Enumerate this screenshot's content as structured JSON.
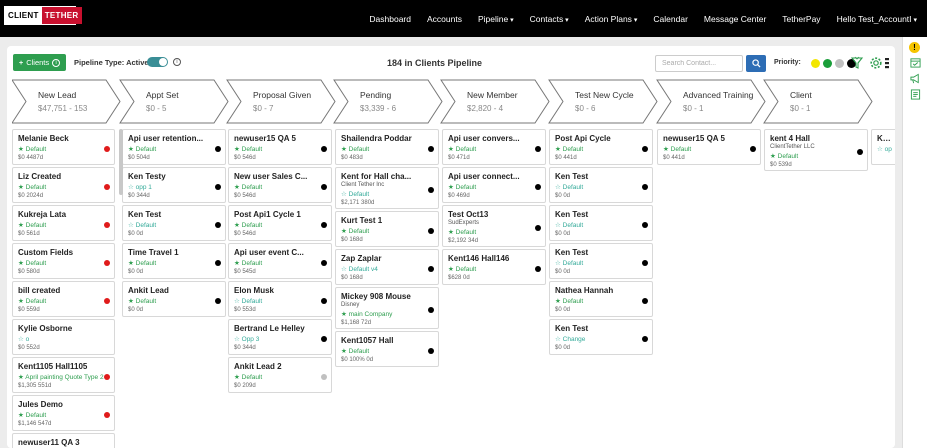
{
  "logo": {
    "part1": "CLIENT",
    "part2": "TETHER"
  },
  "nav": {
    "items": [
      {
        "label": "Dashboard",
        "dropdown": false
      },
      {
        "label": "Accounts",
        "dropdown": false
      },
      {
        "label": "Pipeline",
        "dropdown": true
      },
      {
        "label": "Contacts",
        "dropdown": true
      },
      {
        "label": "Action Plans",
        "dropdown": true
      },
      {
        "label": "Calendar",
        "dropdown": false
      },
      {
        "label": "Message Center",
        "dropdown": false
      },
      {
        "label": "TetherPay",
        "dropdown": false
      },
      {
        "label": "Hello Test_AccountI",
        "dropdown": true
      }
    ]
  },
  "toolbar": {
    "add_button_label": "Clients",
    "pipeline_type_label": "Pipeline Type: Active",
    "toggle_on": true,
    "title": "184 in Clients Pipeline",
    "search_placeholder": "Search Contact...",
    "priority_label": "Priority:",
    "priority_colors": [
      "#f2e600",
      "#1a9e3a",
      "#c0c0c0",
      "#000000"
    ]
  },
  "stages": [
    {
      "name": "New Lead",
      "summary": "$47,751 - 153"
    },
    {
      "name": "Appt Set",
      "summary": "$0 - 5"
    },
    {
      "name": "Proposal Given",
      "summary": "$0 - 7"
    },
    {
      "name": "Pending",
      "summary": "$3,339 - 6"
    },
    {
      "name": "New Member",
      "summary": "$2,820 - 4"
    },
    {
      "name": "Test New Cycle",
      "summary": "$0 - 6"
    },
    {
      "name": "Advanced Training",
      "summary": "$0 - 1"
    },
    {
      "name": "Client",
      "summary": "$0 - 1"
    }
  ],
  "columns": [
    {
      "cards": [
        {
          "name": "Melanie Beck",
          "tag": "Default",
          "meta": "$0  4487d",
          "dot": "#e01b1b"
        },
        {
          "name": "Liz Created",
          "tag": "Default",
          "meta": "$0  2024d",
          "dot": "#e01b1b"
        },
        {
          "name": "Kukreja Lata",
          "tag": "Default",
          "meta": "$0  561d",
          "dot": "#e01b1b"
        },
        {
          "name": "Custom Fields",
          "tag": "Default",
          "meta": "$0  580d",
          "dot": "#e01b1b"
        },
        {
          "name": "bill created",
          "tag": "Default",
          "meta": "$0  559d",
          "dot": "#e01b1b"
        },
        {
          "name": "Kylie Osborne",
          "tag": "o",
          "tag_outline": true,
          "meta": "$0  552d",
          "dot": ""
        },
        {
          "name": "Kent1105 Hall1105",
          "tag": "April painting Quote Type 2",
          "meta": "$1,305  551d",
          "dot": "#e01b1b"
        },
        {
          "name": "Jules Demo",
          "tag": "Default",
          "meta": "$1,146  547d",
          "dot": "#e01b1b"
        },
        {
          "name": "newuser11 QA 3",
          "tag": "",
          "meta": "",
          "dot": "#e01b1b"
        }
      ]
    },
    {
      "cards": [
        {
          "name": "Api user retention...",
          "tag": "Default",
          "meta": "$0  504d",
          "dot": "#000"
        },
        {
          "name": "Ken Testy",
          "tag": "opp 1",
          "tag_outline": true,
          "meta": "$0  344d",
          "dot": "#000"
        },
        {
          "name": "Ken Test",
          "tag": "Default",
          "tag_outline": true,
          "meta": "$0  0d",
          "dot": "#000"
        },
        {
          "name": "Time Travel 1",
          "tag": "Default",
          "meta": "$0  0d",
          "dot": "#000"
        },
        {
          "name": "Ankit Lead",
          "tag": "Default",
          "meta": "$0  0d",
          "dot": "#000"
        }
      ]
    },
    {
      "cards": [
        {
          "name": "newuser15 QA 5",
          "tag": "Default",
          "meta": "$0  546d",
          "dot": "#000"
        },
        {
          "name": "New user Sales C...",
          "tag": "Default",
          "meta": "$0  546d",
          "dot": "#000"
        },
        {
          "name": "Post Api1 Cycle 1",
          "tag": "Default",
          "meta": "$0  546d",
          "dot": "#000"
        },
        {
          "name": "Api user event C...",
          "tag": "Default",
          "meta": "$0  545d",
          "dot": "#000"
        },
        {
          "name": "Elon Musk",
          "tag": "Default",
          "tag_outline": true,
          "meta": "$0  553d",
          "dot": "#000"
        },
        {
          "name": "Bertrand Le Helley",
          "tag": "Opp 3",
          "tag_outline": true,
          "meta": "$0  344d",
          "dot": "#000"
        },
        {
          "name": "Ankit Lead 2",
          "tag": "Default",
          "meta": "$0  209d",
          "dot": "#c0c0c0"
        }
      ]
    },
    {
      "cards": [
        {
          "name": "Shailendra Poddar",
          "tag": "Default",
          "meta": "$0  483d",
          "dot": "#000"
        },
        {
          "name": "Kent for Hall cha...",
          "org": "Client Tether Inc",
          "tag": "Default",
          "tag_outline": true,
          "meta": "$2,171  380d",
          "dot": "#000"
        },
        {
          "name": "Kurt Test 1",
          "tag": "Default",
          "meta": "$0  168d",
          "dot": "#000"
        },
        {
          "name": "Zap Zaplar",
          "tag": "Default v4",
          "tag_outline": true,
          "meta": "$0  168d",
          "dot": "#000"
        },
        {
          "name": "Mickey 908 Mouse",
          "org": "Disney",
          "tag": "main Company",
          "meta": "$1,168  72d",
          "dot": "#000"
        },
        {
          "name": "Kent1057 Hall",
          "tag": "Default",
          "meta": "$0  100%  0d",
          "dot": "#000"
        }
      ]
    },
    {
      "cards": [
        {
          "name": "Api user convers...",
          "tag": "Default",
          "meta": "$0  471d",
          "dot": "#000"
        },
        {
          "name": "Api user connect...",
          "tag": "Default",
          "meta": "$0  469d",
          "dot": "#000"
        },
        {
          "name": "Test Oct13",
          "org": "SudExperts",
          "tag": "Default",
          "meta": "$2,192  34d",
          "dot": "#000"
        },
        {
          "name": "Kent146 Hall146",
          "tag": "Default",
          "meta": "$628  0d",
          "dot": "#000"
        }
      ]
    },
    {
      "cards": [
        {
          "name": "Post Api Cycle",
          "tag": "Default",
          "meta": "$0  441d",
          "dot": "#000"
        },
        {
          "name": "Ken Test",
          "tag": "Default",
          "tag_outline": true,
          "meta": "$0  0d",
          "dot": "#000"
        },
        {
          "name": "Ken Test",
          "tag": "Default",
          "tag_outline": true,
          "meta": "$0  0d",
          "dot": "#000"
        },
        {
          "name": "Ken Test",
          "tag": "Default",
          "tag_outline": true,
          "meta": "$0  0d",
          "dot": "#000"
        },
        {
          "name": "Nathea Hannah",
          "tag": "Default",
          "meta": "$0  0d",
          "dot": "#000"
        },
        {
          "name": "Ken Test",
          "tag": "Change",
          "tag_outline": true,
          "meta": "$0  0d",
          "dot": "#000"
        }
      ]
    },
    {
      "cards": [
        {
          "name": "newuser15 QA 5",
          "tag": "Default",
          "meta": "$0  441d",
          "dot": "#000"
        }
      ]
    },
    {
      "cards": [
        {
          "name": "kent 4 Hall",
          "org": "ClientTether LLC",
          "tag": "Default",
          "meta": "$0  539d",
          "dot": "#000"
        }
      ]
    },
    {
      "cards": [
        {
          "name": "Ken",
          "tag": "op",
          "tag_outline": true,
          "meta": "",
          "dot": ""
        }
      ]
    }
  ]
}
